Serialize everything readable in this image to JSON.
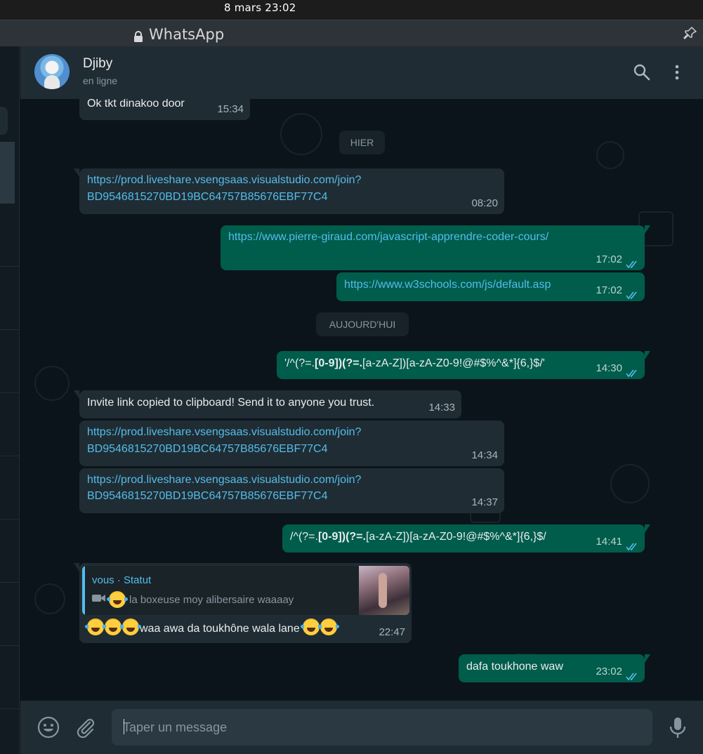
{
  "os_bar": {
    "clock": "8 mars  23:02"
  },
  "window": {
    "title": "WhatsApp"
  },
  "chat_header": {
    "name": "Djiby",
    "status": "en ligne"
  },
  "messages": [
    {
      "dir": "in",
      "text": "Ok tkt dinakoo door",
      "time": "15:34"
    },
    {
      "divider": "HIER"
    },
    {
      "dir": "in",
      "line1": "https://prod.liveshare.vsengsaas.visualstudio.com/join?",
      "line2": "BD9546815270BD19BC64757B85676EBF77C4",
      "time": "08:20"
    },
    {
      "dir": "out",
      "text": "https://www.pierre-giraud.com/javascript-apprendre-coder-cours/",
      "time": "17:02",
      "status": "read"
    },
    {
      "dir": "out",
      "text": "https://www.w3schools.com/js/default.asp",
      "time": "17:02",
      "status": "read"
    },
    {
      "divider": "AUJOURD'HUI"
    },
    {
      "dir": "out",
      "parts": [
        "'/^(?=.",
        "[0-9])",
        "(?=.",
        "[a-zA-Z])[a-zA-Z0-9!@#$%^&*]{6,}$/'"
      ],
      "time": "14:30",
      "status": "read"
    },
    {
      "dir": "in",
      "text": "Invite link copied to clipboard! Send it to anyone you trust.",
      "time": "14:33"
    },
    {
      "dir": "in",
      "line1": "https://prod.liveshare.vsengsaas.visualstudio.com/join?",
      "line2": "BD9546815270BD19BC64757B85676EBF77C4",
      "time": "14:34"
    },
    {
      "dir": "in",
      "line1": "https://prod.liveshare.vsengsaas.visualstudio.com/join?",
      "line2": "BD9546815270BD19BC64757B85676EBF77C4",
      "time": "14:37"
    },
    {
      "dir": "out",
      "parts": [
        "/^(?=.",
        "[0-9])",
        "(?=.",
        "[a-zA-Z])[a-zA-Z0-9!@#$%^&*]{6,}$/"
      ],
      "time": "14:41",
      "status": "read"
    },
    {
      "dir": "in",
      "quote_author": "vous · Statut",
      "quote_text": "la boxeuse moy alibersaire waaaay",
      "text": "waa awa da toukhône wala lane",
      "time": "22:47"
    },
    {
      "dir": "out",
      "text": "dafa toukhone waw",
      "time": "23:02",
      "status": "read"
    }
  ],
  "composer": {
    "placeholder": "Taper un message"
  },
  "icons": {
    "lock": "lock-icon",
    "pin": "pin-icon",
    "search": "search-icon",
    "menu": "kebab-menu-icon",
    "emoji": "emoji-icon",
    "attach": "paperclip-icon",
    "mic": "microphone-icon",
    "camera": "video-camera-icon",
    "ticks": "double-check-icon"
  },
  "colors": {
    "incoming_bubble": "#202c33",
    "outgoing_bubble": "#005c4b",
    "link": "#53bdeb",
    "read_ticks": "#53bdeb",
    "background": "#0b141a",
    "header": "#202c33"
  }
}
